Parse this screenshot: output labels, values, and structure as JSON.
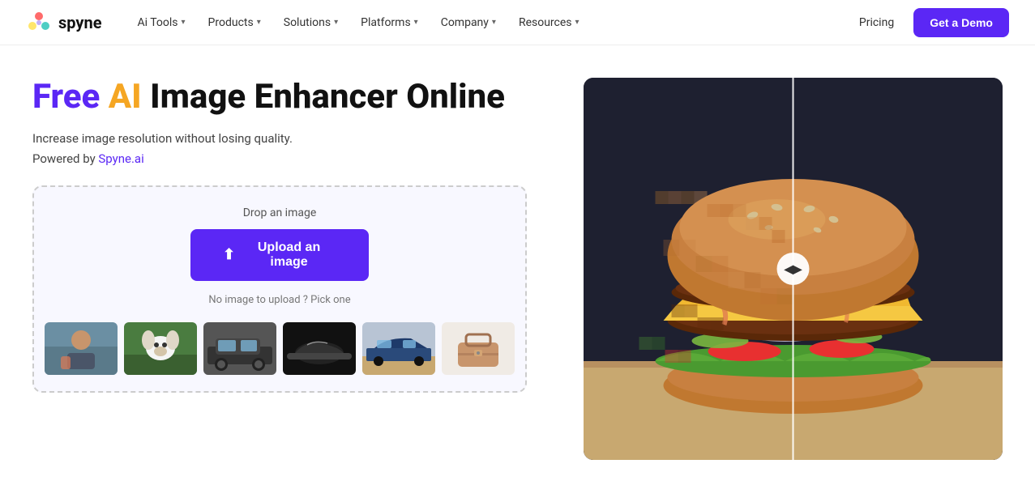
{
  "navbar": {
    "logo_text": "spyne",
    "nav_items": [
      {
        "label": "Ai Tools",
        "has_dropdown": true
      },
      {
        "label": "Products",
        "has_dropdown": true
      },
      {
        "label": "Solutions",
        "has_dropdown": true
      },
      {
        "label": "Platforms",
        "has_dropdown": true
      },
      {
        "label": "Company",
        "has_dropdown": true
      },
      {
        "label": "Resources",
        "has_dropdown": true
      }
    ],
    "pricing_label": "Pricing",
    "demo_button_label": "Get a Demo"
  },
  "hero": {
    "title_free": "Free",
    "title_ai": "AI",
    "title_rest": " Image Enhancer Online",
    "subtitle1": "Increase image resolution without losing quality.",
    "powered_by_text": "Powered by ",
    "powered_by_link": "Spyne.ai"
  },
  "upload_area": {
    "drop_text": "Drop an image",
    "upload_button_label": "Upload an image",
    "pick_text": "No image to upload ? Pick one"
  },
  "comparison": {
    "slider_icon": "◀▶"
  }
}
